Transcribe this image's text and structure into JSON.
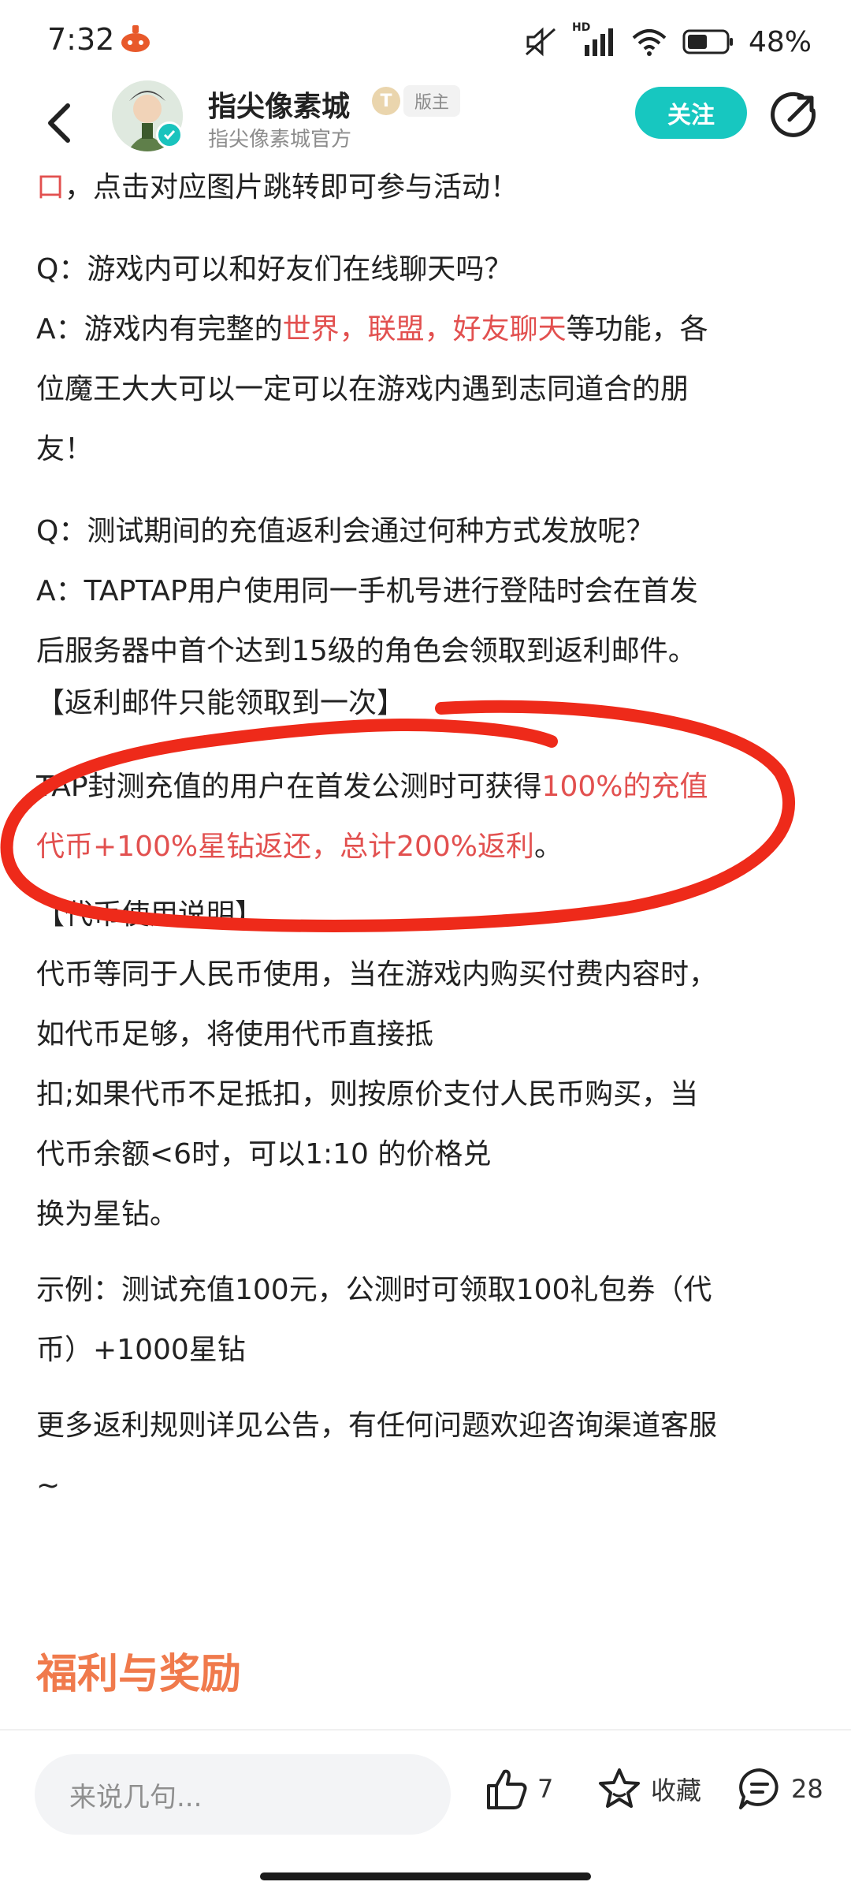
{
  "status_bar": {
    "time": "7:32",
    "battery": "48%",
    "network": "HD"
  },
  "header": {
    "author_name": "指尖像素城",
    "level_badge": "T",
    "role_badge": "版主",
    "author_sub": "指尖像素城官方",
    "follow_label": "关注"
  },
  "content": {
    "p1a": "口",
    "p1b": "，点击对应图片跳转即可参与活动！",
    "q1": "Q：游戏内可以和好友们在线聊天吗？",
    "a1a": "A：游戏内有完整的",
    "a1b": "世界，联盟，好友聊天",
    "a1c": "等功能，各",
    "a1d": "位魔王大大可以一定可以在游戏内遇到志同道合的朋",
    "a1e": "友！",
    "q2": "Q：测试期间的充值返利会通过何种方式发放呢？",
    "a2a": "A：TAPTAP用户使用同一手机号进行登陆时会在首发",
    "a2b": "后服务器中首个达到15级的角色会领取到返利邮件。",
    "a2c": "【返利邮件只能领取到一次】",
    "tap1a": "TAP封测充值的用户在首发公测时可获得",
    "tap1b": "100%的充值",
    "tap2a": "代币+100%星钻返还，总计200%返利",
    "tap2b": "。",
    "coin_title": "【代币使用说明】",
    "coin1": "代币等同于人民币使用，当在游戏内购买付费内容时，",
    "coin2": "如代币足够，将使用代币直接抵",
    "coin3": "扣;如果代币不足抵扣，则按原价支付人民币购买，当",
    "coin4": "代币余额<6时，可以1:10 的价格兑",
    "coin5": "换为星钻。",
    "ex1": "示例：测试充值100元，公测时可领取100礼包券（代",
    "ex2": "币）+1000星钻",
    "more1": "更多返利规则详见公告，有任何问题欢迎咨询渠道客服",
    "more2": "~",
    "section_title": "福利与奖励"
  },
  "bottom_bar": {
    "comment_placeholder": "来说几句...",
    "like_count": "7",
    "favorite_label": "收藏",
    "comment_count": "28"
  },
  "colors": {
    "highlight": "#e2504f",
    "accent": "#17c7c0",
    "section": "#f07a4c",
    "annotation": "#ee2a1a"
  },
  "icons": [
    "back-arrow-icon",
    "verified-icon",
    "share-icon",
    "thumbs-up-icon",
    "star-icon",
    "comment-icon"
  ]
}
